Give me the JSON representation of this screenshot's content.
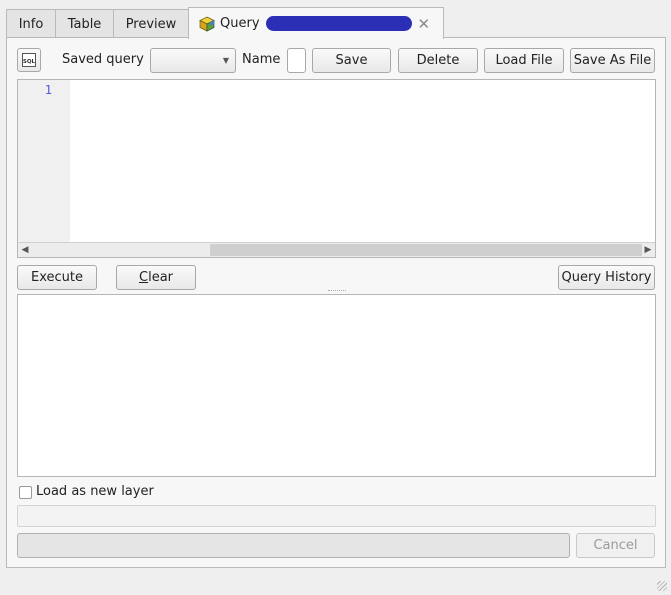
{
  "tabs": [
    {
      "label": "Info"
    },
    {
      "label": "Table"
    },
    {
      "label": "Preview"
    },
    {
      "label": "Query",
      "active": true
    }
  ],
  "toolbar": {
    "sql_icon_text": "SQL",
    "saved_query_label": "Saved query",
    "saved_query_value": "",
    "name_label": "Name",
    "name_value": "",
    "save_label": "Save",
    "delete_label": "Delete",
    "load_file_label": "Load File",
    "save_as_file_label": "Save As File"
  },
  "editor": {
    "line_numbers": [
      "1"
    ],
    "content": ""
  },
  "actions": {
    "execute_label": "Execute",
    "clear_label": "Clear",
    "query_history_label": "Query History"
  },
  "bottom": {
    "load_as_layer_label": "Load as new layer",
    "load_as_layer_checked": false,
    "layer_name_value": "",
    "cancel_label": "Cancel"
  },
  "colors": {
    "redaction": "#2b2fb5",
    "line_number": "#4a5cd6"
  }
}
